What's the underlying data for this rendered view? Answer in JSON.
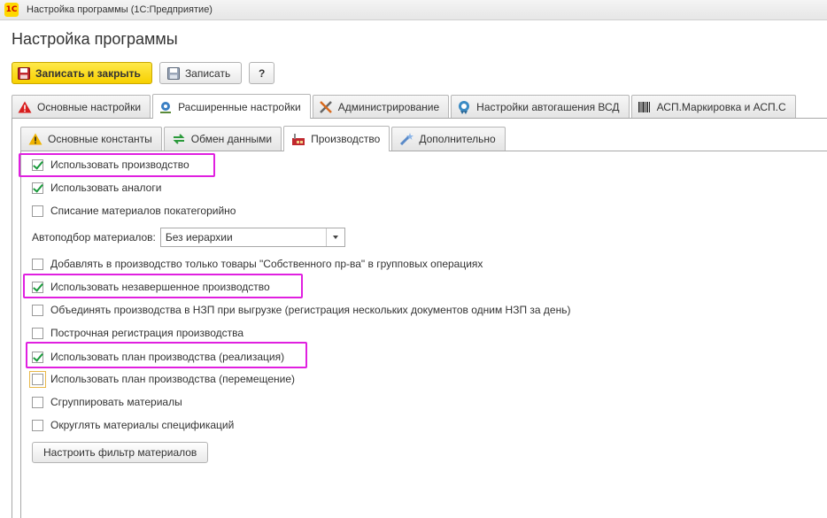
{
  "window": {
    "title": "Настройка программы  (1С:Предприятие)",
    "app_icon_text": "1С"
  },
  "page_title": "Настройка программы",
  "toolbar": {
    "save_close_label": "Записать и закрыть",
    "save_label": "Записать",
    "help_label": "?"
  },
  "outer_tabs": [
    {
      "label": "Основные настройки",
      "icon": "warning-icon"
    },
    {
      "label": "Расширенные настройки",
      "icon": "gear-network-icon",
      "active": true
    },
    {
      "label": "Администрирование",
      "icon": "tools-icon"
    },
    {
      "label": "Настройки автогашения ВСД",
      "icon": "certificate-icon"
    },
    {
      "label": "АСП.Маркировка и АСП.С",
      "icon": "barcode-icon"
    }
  ],
  "inner_tabs": [
    {
      "label": "Основные константы",
      "icon": "warning-icon"
    },
    {
      "label": "Обмен данными",
      "icon": "exchange-icon"
    },
    {
      "label": "Производство",
      "icon": "factory-icon",
      "active": true
    },
    {
      "label": "Дополнительно",
      "icon": "wand-icon"
    }
  ],
  "options": {
    "use_production": {
      "label": "Использовать производство",
      "checked": true
    },
    "use_analogs": {
      "label": "Использовать аналоги",
      "checked": true
    },
    "writeoff_by_category": {
      "label": "Списание материалов покатегорийно",
      "checked": false
    },
    "own_goods_only": {
      "label": "Добавлять в производство только товары  \"Собственного пр-ва\" в групповых операциях",
      "checked": false
    },
    "use_wip": {
      "label": "Использовать незавершенное производство",
      "checked": true
    },
    "merge_wip": {
      "label": "Объединять производства в НЗП при выгрузке (регистрация нескольких документов одним НЗП за день)",
      "checked": false
    },
    "line_registration": {
      "label": "Построчная регистрация производства",
      "checked": false
    },
    "plan_sales": {
      "label": "Использовать план производства (реализация)",
      "checked": true
    },
    "plan_transfer": {
      "label": "Использовать план производства (перемещение)",
      "checked": false
    },
    "group_materials": {
      "label": "Сгруппировать материалы",
      "checked": false
    },
    "round_materials": {
      "label": "Округлять материалы спецификаций",
      "checked": false
    }
  },
  "autoselect": {
    "label": "Автоподбор материалов:",
    "value": "Без иерархии"
  },
  "filter_button_label": "Настроить фильтр материалов",
  "colors": {
    "highlight": "#e020e0",
    "primary_button": "#f7d000",
    "check": "#1a9a3c"
  }
}
